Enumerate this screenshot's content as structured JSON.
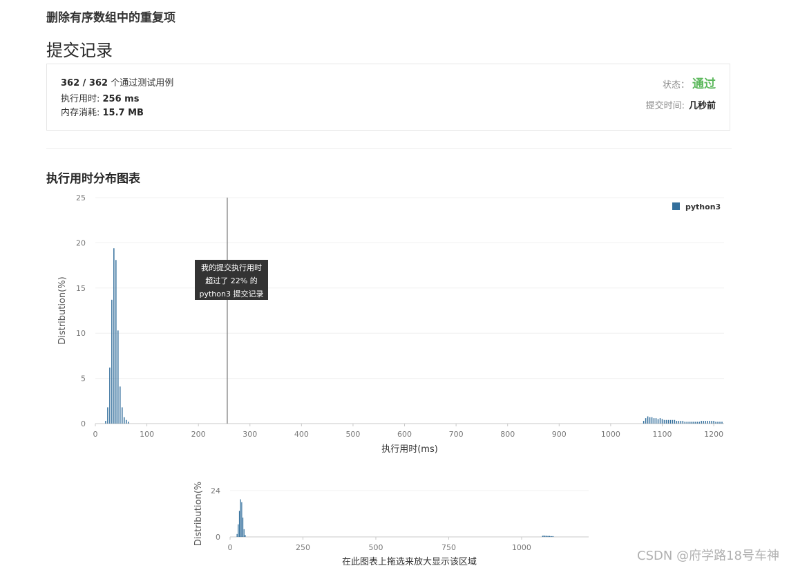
{
  "problem": {
    "title": "删除有序数组中的重复项"
  },
  "section_title": "提交记录",
  "summary": {
    "cases_passed": "362 / 362",
    "cases_label": " 个通过测试用例",
    "runtime_label": "执行用时: ",
    "runtime_value": "256 ms",
    "memory_label": "内存消耗: ",
    "memory_value": "15.7 MB",
    "status_label": "状态：",
    "status_value": "通过",
    "submit_time_label": "提交时间:",
    "submit_time_value": "几秒前"
  },
  "colors": {
    "bar": "#336f9c",
    "status": "#5cb85c"
  },
  "chart_data": [
    {
      "type": "bar",
      "title": "执行用时分布图表",
      "xlabel": "执行用时(ms)",
      "ylabel": "Distribution(%)",
      "xlim": [
        0,
        1220
      ],
      "ylim": [
        0,
        25
      ],
      "x_ticks": [
        0,
        100,
        200,
        300,
        400,
        500,
        600,
        700,
        800,
        900,
        1000,
        1100,
        1200
      ],
      "y_ticks": [
        0,
        5,
        10,
        15,
        20,
        25
      ],
      "legend": "top-right",
      "series": [
        {
          "name": "python3"
        }
      ],
      "bar_width": 4,
      "x": [
        20,
        24,
        28,
        32,
        36,
        40,
        44,
        48,
        52,
        56,
        60,
        64,
        1064,
        1068,
        1072,
        1076,
        1080,
        1084,
        1088,
        1092,
        1096,
        1100,
        1104,
        1108,
        1112,
        1116,
        1120,
        1124,
        1128,
        1132,
        1136,
        1140,
        1144,
        1148,
        1152,
        1156,
        1160,
        1164,
        1168,
        1172,
        1176,
        1180,
        1184,
        1188,
        1192,
        1196,
        1200,
        1204,
        1208,
        1212,
        1216
      ],
      "values": [
        0.3,
        1.8,
        6.2,
        13.7,
        19.4,
        18.1,
        10.3,
        4.1,
        1.8,
        0.7,
        0.4,
        0.2,
        0.3,
        0.6,
        0.8,
        0.7,
        0.7,
        0.6,
        0.6,
        0.5,
        0.6,
        0.5,
        0.4,
        0.4,
        0.4,
        0.4,
        0.4,
        0.4,
        0.3,
        0.3,
        0.3,
        0.3,
        0.2,
        0.2,
        0.2,
        0.2,
        0.2,
        0.2,
        0.2,
        0.2,
        0.3,
        0.3,
        0.3,
        0.3,
        0.3,
        0.3,
        0.3,
        0.2,
        0.2,
        0.2,
        0.2
      ],
      "marker": {
        "x": 256,
        "tooltip": [
          "我的提交执行用时",
          "超过了 22% 的",
          "python3 提交记录"
        ]
      }
    },
    {
      "type": "bar",
      "title": "",
      "xlabel": "在此图表上拖选来放大显示该区域",
      "ylabel": "Distribution(%",
      "xlim": [
        0,
        1230
      ],
      "ylim": [
        0,
        24
      ],
      "x_ticks": [
        0,
        250,
        500,
        750,
        1000
      ],
      "y_ticks": [
        0,
        24
      ],
      "bar_width": 4,
      "x": [
        24,
        28,
        32,
        36,
        40,
        44,
        48,
        52,
        1072,
        1076,
        1080,
        1084,
        1088,
        1092,
        1096,
        1100,
        1104,
        1108
      ],
      "values": [
        1.5,
        6.5,
        13.5,
        19.5,
        18.0,
        10.0,
        4.0,
        1.0,
        0.6,
        0.7,
        0.6,
        0.6,
        0.5,
        0.5,
        0.5,
        0.4,
        0.4,
        0.4
      ]
    }
  ],
  "watermark": "CSDN @府学路18号车神"
}
